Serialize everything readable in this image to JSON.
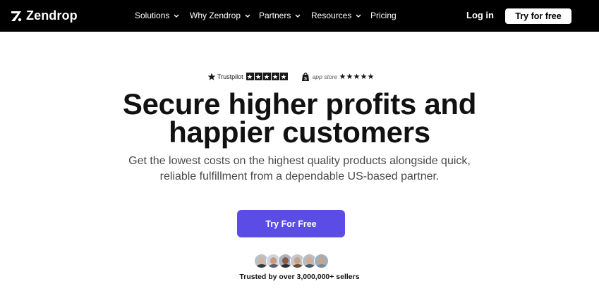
{
  "brand": {
    "name": "Zendrop"
  },
  "nav": {
    "items": [
      {
        "label": "Solutions",
        "has_dropdown": true
      },
      {
        "label": "Why Zendrop",
        "has_dropdown": true
      },
      {
        "label": "Partners",
        "has_dropdown": true
      },
      {
        "label": "Resources",
        "has_dropdown": true
      },
      {
        "label": "Pricing",
        "has_dropdown": false
      }
    ],
    "login_label": "Log in",
    "try_label": "Try for free"
  },
  "ratings": {
    "trustpilot_label": "Trustpilot",
    "trustpilot_stars": 5,
    "appstore_label": "app store",
    "appstore_stars": 5
  },
  "hero": {
    "headline_line1": "Secure higher profits and",
    "headline_line2": "happier customers",
    "sub_line1": "Get the lowest costs on the highest quality products alongside quick,",
    "sub_line2": "reliable fulfillment from a dependable US-based partner.",
    "cta_label": "Try For Free",
    "trusted_text": "Trusted by over 3,000,000+ sellers"
  },
  "avatars": [
    {
      "skin": "#d9b49a",
      "shirt": "#3a3a3a",
      "bg": "#b8c2cc"
    },
    {
      "skin": "#c99a7e",
      "shirt": "#5a5f66",
      "bg": "#cfd5db"
    },
    {
      "skin": "#8a5a44",
      "shirt": "#2c2c2c",
      "bg": "#a9b4be"
    },
    {
      "skin": "#caa183",
      "shirt": "#6b4b3a",
      "bg": "#c2c8ce"
    },
    {
      "skin": "#d7ab8c",
      "shirt": "#4b5a6a",
      "bg": "#b5bec7"
    },
    {
      "skin": "#c9a48a",
      "shirt": "#7a8a96",
      "bg": "#9fb0bd"
    }
  ],
  "colors": {
    "nav_bg": "#000000",
    "cta_bg": "#5b4ce6",
    "text": "#111111",
    "muted_text": "#4a4a4a"
  }
}
